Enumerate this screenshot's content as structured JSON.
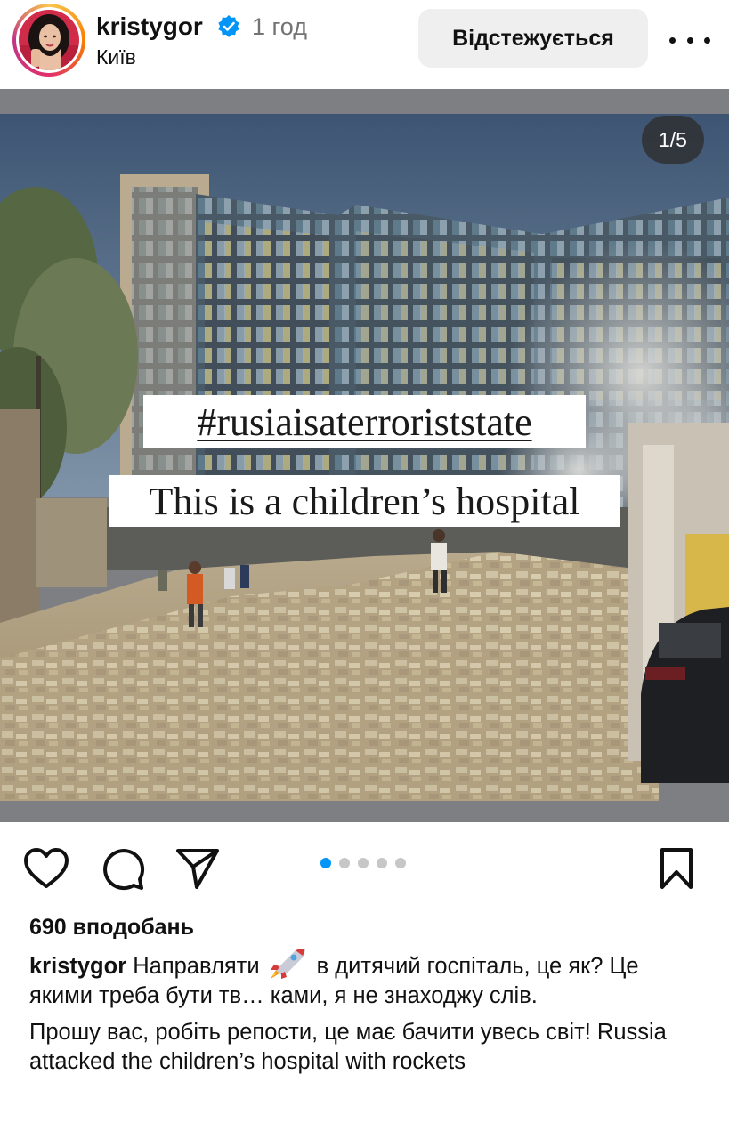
{
  "header": {
    "username": "kristygor",
    "verified": true,
    "time_ago": "1 год",
    "location": "Київ",
    "follow_label": "Відстежується",
    "more_icon": "more-horizontal-icon"
  },
  "post": {
    "slide_counter": "1/5",
    "overlay_hashtag": "#rusiaisaterroriststate",
    "overlay_caption": "This is a children’s hospital",
    "slides_total": 5,
    "active_slide": 1
  },
  "actions": {
    "like_icon": "heart-icon",
    "comment_icon": "comment-icon",
    "share_icon": "share-icon",
    "save_icon": "bookmark-icon",
    "active_dot_color": "#0095f6"
  },
  "likes_text": "690 вподобань",
  "caption": {
    "username": "kristygor",
    "text_before_emoji": "Направляти",
    "emoji": "🚀",
    "text_after_emoji": "в дитячий госпіталь, це як? Це якими треба бути тв… ками, я не знаходжу слів.",
    "paragraph2": "Прошу вас, робіть репости, це має бачити увесь світ! Russia attacked the children’s hospital with rockets"
  }
}
